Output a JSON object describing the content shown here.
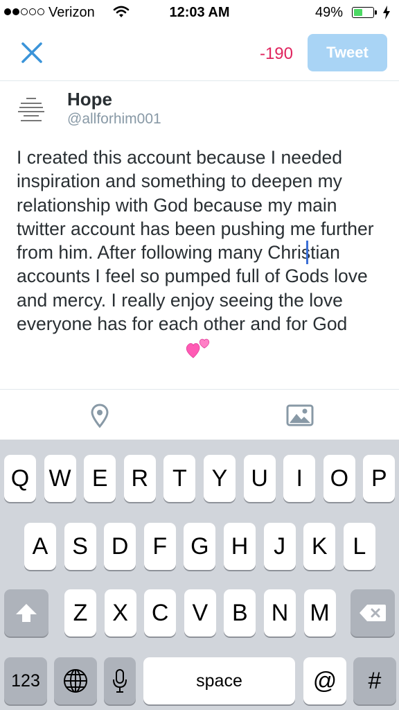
{
  "status_bar": {
    "signal_bars_filled": 2,
    "signal_bars_total": 5,
    "carrier": "Verizon",
    "wifi_icon": "wifi-icon",
    "time": "12:03 AM",
    "battery_percent": "49%",
    "battery_level": 0.49,
    "charging_icon": "bolt-icon"
  },
  "compose_header": {
    "close_icon": "close-x-icon",
    "char_count": "-190",
    "tweet_label": "Tweet"
  },
  "account": {
    "name": "Hope",
    "handle": "@allforhim001"
  },
  "tweet_text": "I created this account because I needed inspiration and something to deepen my relationship with God because my main twitter account has been pushing me further from him. After following many Christian accounts I feel so pumped full of Gods love and mercy. I really enjoy seeing the love everyone has for each other and for God",
  "tweet_emoji_icon": "two-hearts-emoji",
  "toolbar": {
    "location_icon": "location-pin-icon",
    "photo_icon": "photo-icon"
  },
  "keyboard": {
    "row1": [
      "Q",
      "W",
      "E",
      "R",
      "T",
      "Y",
      "U",
      "I",
      "O",
      "P"
    ],
    "row2": [
      "A",
      "S",
      "D",
      "F",
      "G",
      "H",
      "J",
      "K",
      "L"
    ],
    "row3": [
      "Z",
      "X",
      "C",
      "V",
      "B",
      "N",
      "M"
    ],
    "shift_icon": "shift-arrow-icon",
    "delete_icon": "backspace-icon",
    "numbers_label": "123",
    "globe_icon": "globe-icon",
    "mic_icon": "microphone-icon",
    "space_label": "space",
    "at_label": "@",
    "hash_label": "#"
  }
}
